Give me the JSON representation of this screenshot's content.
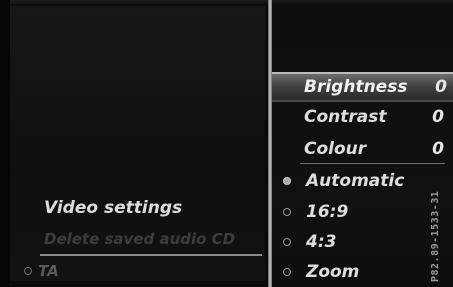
{
  "left_menu": {
    "video_settings": "Video settings",
    "delete_saved_audio": "Delete saved audio CD",
    "ta_label": "TA"
  },
  "right_menu": {
    "sliders": [
      {
        "label": "Brightness",
        "value": "0",
        "selected": true
      },
      {
        "label": "Contrast",
        "value": "0",
        "selected": false
      },
      {
        "label": "Colour",
        "value": "0",
        "selected": false
      }
    ],
    "options": [
      {
        "label": "Automatic",
        "selected": true
      },
      {
        "label": "16:9",
        "selected": false
      },
      {
        "label": "4:3",
        "selected": false
      },
      {
        "label": "Zoom",
        "selected": false
      }
    ]
  },
  "reference_code": "P82.89-1533-31"
}
